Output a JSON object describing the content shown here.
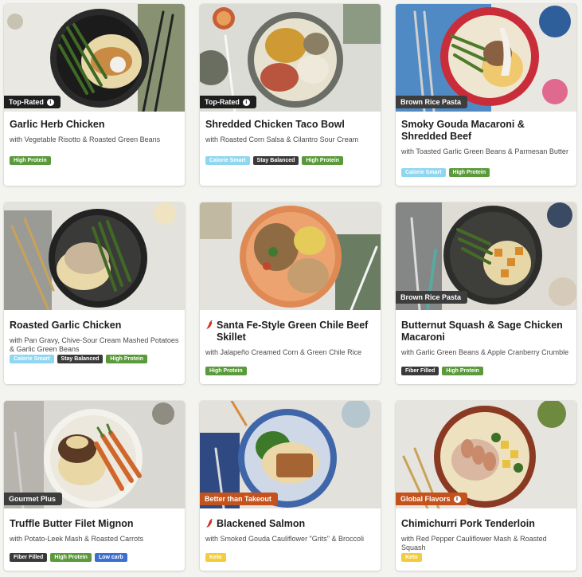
{
  "colors": {
    "page_bg": "#f3f3ef",
    "tag_high_protein": "#5a9a3b",
    "tag_calorie_smart": "#8fd6f0",
    "tag_stay_balanced": "#3a3a3a",
    "tag_fiber_filled": "#3a3a3a",
    "tag_low_carb": "#3d6fd0",
    "tag_keto": "#f3cc3d",
    "ribbon_dark": "#1e1e1e",
    "ribbon_orange": "#c4521c",
    "ribbon_gray": "#3d3d3d"
  },
  "cards": [
    {
      "title": "Garlic Herb Chicken",
      "subtitle": "with Vegetable Risotto & Roasted Green Beans",
      "ribbon": "Top-Rated",
      "ribbon_icon": "info-icon",
      "tags": [
        "High Protein"
      ]
    },
    {
      "title": "Shredded Chicken Taco Bowl",
      "subtitle": "with Roasted Corn Salsa & Cilantro Sour Cream",
      "ribbon": "Top-Rated",
      "ribbon_icon": "info-icon",
      "tags": [
        "Calorie Smart",
        "Stay Balanced",
        "High Protein"
      ]
    },
    {
      "title": "Smoky Gouda Macaroni & Shredded Beef",
      "subtitle": "with Toasted Garlic Green Beans & Parmesan Butter",
      "ribbon": "Brown Rice Pasta",
      "tags": [
        "Calorie Smart",
        "High Protein"
      ]
    },
    {
      "title": "Roasted Garlic Chicken",
      "subtitle": "with Pan Gravy, Chive-Sour Cream Mashed Potatoes & Garlic Green Beans",
      "ribbon": "",
      "tags": [
        "Calorie Smart",
        "Stay Balanced",
        "High Protein"
      ]
    },
    {
      "title": "Santa Fe-Style Green Chile Beef Skillet",
      "subtitle": "with Jalapeño Creamed Corn & Green Chile Rice",
      "ribbon": "",
      "spicy_icon": "chili-pepper-icon",
      "tags": [
        "High Protein"
      ]
    },
    {
      "title": "Butternut Squash & Sage Chicken Macaroni",
      "subtitle": "with Garlic Green Beans & Apple Cranberry Crumble",
      "ribbon": "Brown Rice Pasta",
      "tags": [
        "Fiber Filled",
        "High Protein"
      ]
    },
    {
      "title": "Truffle Butter Filet Mignon",
      "subtitle": "with Potato-Leek Mash & Roasted Carrots",
      "ribbon": "Gourmet Plus",
      "tags": [
        "Fiber Filled",
        "High Protein",
        "Low carb"
      ]
    },
    {
      "title": "Blackened Salmon",
      "subtitle": "with Smoked Gouda Cauliflower \"Grits\" & Broccoli",
      "ribbon": "Better than Takeout",
      "tags": [
        "Keto"
      ]
    },
    {
      "title": "Chimichurri Pork Tenderloin",
      "subtitle": "with Red Pepper Cauliflower Mash & Roasted Squash",
      "ribbon": "Global Flavors",
      "ribbon_icon": "info-icon",
      "tags": [
        "Keto"
      ]
    }
  ]
}
